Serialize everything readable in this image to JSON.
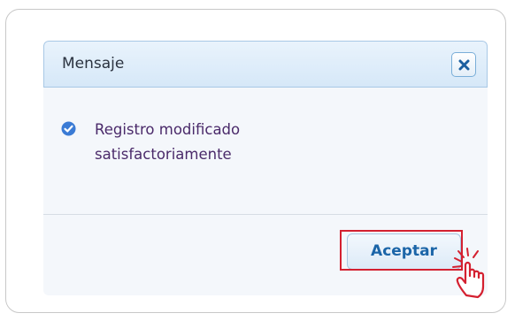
{
  "dialog": {
    "title": "Mensaje",
    "message": "Registro modificado satisfactoriamente",
    "accept_label": "Aceptar",
    "icons": {
      "close": "close-icon",
      "status": "check-circle-icon",
      "pointer": "hand-pointer-icon"
    }
  },
  "colors": {
    "title_bar": "#d6e8f8",
    "message_text": "#4a2a6a",
    "button_text": "#1b65a8",
    "check_icon": "#3a7bd5",
    "highlight": "#d42030"
  }
}
